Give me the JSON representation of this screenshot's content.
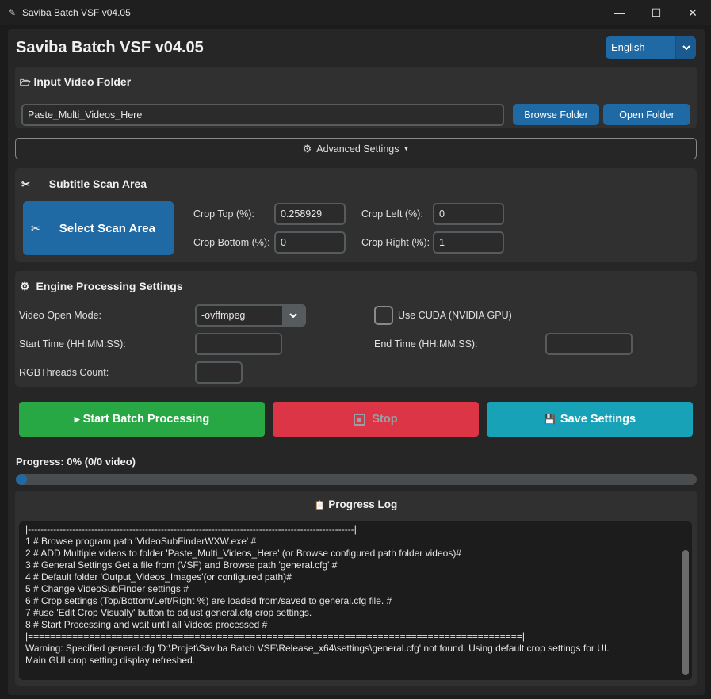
{
  "window": {
    "title": "Saviba Batch VSF v04.05",
    "minimize": "—",
    "maximize": "☐",
    "close": "✕"
  },
  "app_title": "Saviba Batch VSF v04.05",
  "language": {
    "selected": "English"
  },
  "input_section": {
    "title": "Input Video Folder",
    "folder_value": "Paste_Multi_Videos_Here",
    "browse_label": "Browse Folder",
    "open_label": "Open Folder"
  },
  "advanced": {
    "label": "Advanced Settings"
  },
  "scan_area": {
    "title": "Subtitle Scan Area",
    "select_label": "Select Scan Area",
    "crop_top_label": "Crop Top (%):",
    "crop_top_value": "0.258929",
    "crop_bottom_label": "Crop Bottom (%):",
    "crop_bottom_value": "0",
    "crop_left_label": "Crop Left (%):",
    "crop_left_value": "0",
    "crop_right_label": "Crop Right (%):",
    "crop_right_value": "1"
  },
  "engine": {
    "title": "Engine Processing Settings",
    "open_mode_label": "Video Open Mode:",
    "open_mode_value": "-ovffmpeg",
    "cuda_label": "Use CUDA (NVIDIA GPU)",
    "cuda_checked": false,
    "start_time_label": "Start Time (HH:MM:SS):",
    "start_time_value": "",
    "end_time_label": "End Time (HH:MM:SS):",
    "end_time_value": "",
    "threads_label": "RGBThreads Count:",
    "threads_value": ""
  },
  "actions": {
    "start_label": "Start Batch Processing",
    "stop_label": "Stop",
    "save_label": "Save Settings"
  },
  "progress": {
    "label": "Progress: 0% (0/0 video)",
    "fraction": 0.0
  },
  "log": {
    "title": "Progress Log",
    "lines": [
      "|-------------------------------------------------------------------------------------------------------|",
      "1 # Browse program path 'VideoSubFinderWXW.exe' #",
      "2 # ADD Multiple videos to folder 'Paste_Multi_Videos_Here' (or Browse configured path folder videos)#",
      "3 # General Settings Get a file from (VSF) and Browse path 'general.cfg' #",
      "4 # Default folder 'Output_Videos_Images'(or configured path)#",
      "5 # Change VideoSubFinder settings #",
      "6 # Crop settings (Top/Bottom/Left/Right %) are loaded from/saved to general.cfg file. #",
      "7 #use 'Edit Crop Visually' button to adjust general.cfg crop settings.",
      "8 # Start Processing and wait until all Videos processed #",
      "|=========================================================================================|",
      "Warning: Specified general.cfg 'D:\\Projet\\Saviba Batch VSF\\Release_x64\\settings\\general.cfg' not found. Using default crop settings for UI.",
      "Main GUI crop setting display refreshed."
    ]
  },
  "colors": {
    "accent_blue": "#1f6aa5",
    "start_green": "#28a745",
    "stop_red": "#dc3545",
    "save_teal": "#17a2b8"
  }
}
